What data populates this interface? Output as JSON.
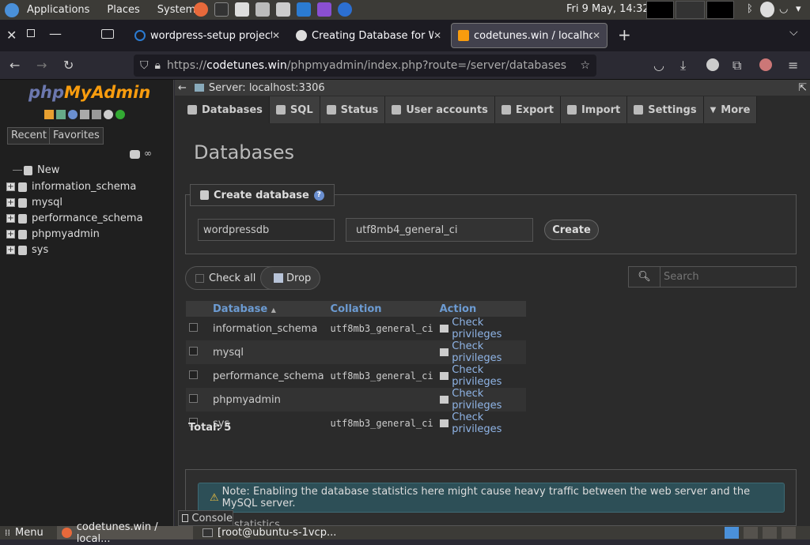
{
  "system_panel": {
    "menus": [
      "Applications",
      "Places",
      "System"
    ],
    "clock": "Fri  9 May, 14:32"
  },
  "browser": {
    "tabs": [
      {
        "title": "wordpress-setup project"
      },
      {
        "title": "Creating Database for Wo"
      },
      {
        "title": "codetunes.win / localhost"
      }
    ],
    "url_scheme": "https://",
    "url_host": "codetunes.win",
    "url_path": "/phpmyadmin/index.php?route=/server/databases"
  },
  "sidebar": {
    "logo_php": "php",
    "logo_my": "MyAdmin",
    "recent_label": "Recent",
    "favorites_label": "Favorites",
    "tree": [
      {
        "label": "New"
      },
      {
        "label": "information_schema"
      },
      {
        "label": "mysql"
      },
      {
        "label": "performance_schema"
      },
      {
        "label": "phpmyadmin"
      },
      {
        "label": "sys"
      }
    ]
  },
  "server_bar": {
    "label": "Server: localhost:3306"
  },
  "pma_tabs": [
    {
      "label": "Databases"
    },
    {
      "label": "SQL"
    },
    {
      "label": "Status"
    },
    {
      "label": "User accounts"
    },
    {
      "label": "Export"
    },
    {
      "label": "Import"
    },
    {
      "label": "Settings"
    },
    {
      "label": "More"
    }
  ],
  "main": {
    "title": "Databases",
    "create": {
      "legend": "Create database",
      "db_name_value": "wordpressdb",
      "collation_value": "utf8mb4_general_ci",
      "button": "Create"
    },
    "check_all": "Check all",
    "drop": "Drop",
    "search_placeholder": "Search",
    "table": {
      "headers": {
        "database": "Database",
        "collation": "Collation",
        "action": "Action"
      },
      "rows": [
        {
          "name": "information_schema",
          "collation": "utf8mb3_general_ci",
          "action": "Check privileges"
        },
        {
          "name": "mysql",
          "collation": "",
          "action": "Check privileges"
        },
        {
          "name": "performance_schema",
          "collation": "utf8mb3_general_ci",
          "action": "Check privileges"
        },
        {
          "name": "phpmyadmin",
          "collation": "",
          "action": "Check privileges"
        },
        {
          "name": "sys",
          "collation": "utf8mb3_general_ci",
          "action": "Check privileges"
        }
      ]
    },
    "total": "Total: 5",
    "notice": "Note: Enabling the database statistics here might cause heavy traffic between the web server and the MySQL server.",
    "stats_label": "statistics"
  },
  "console_label": "Console",
  "taskbar": {
    "menu": "Menu",
    "task1": "codetunes.win / local...",
    "task2": "[root@ubuntu-s-1vcp..."
  }
}
